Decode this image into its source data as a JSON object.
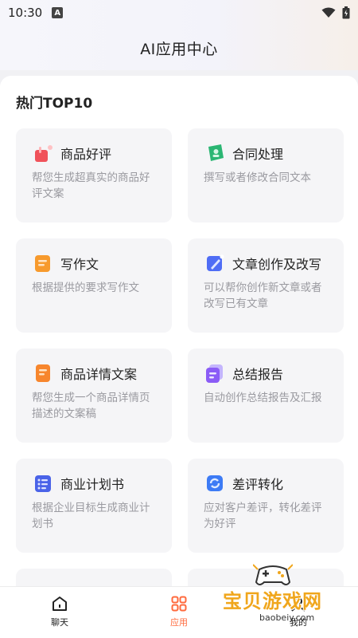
{
  "status": {
    "time": "10:30",
    "a_label": "A"
  },
  "header": {
    "title": "AI应用中心"
  },
  "section": {
    "title": "热门TOP10"
  },
  "cards": [
    {
      "title": "商品好评",
      "desc": "帮您生成超真实的商品好评文案",
      "icon": "gift-icon",
      "color": "#f0525a"
    },
    {
      "title": "合同处理",
      "desc": "撰写或者修改合同文本",
      "icon": "contract-icon",
      "color": "#2bb673"
    },
    {
      "title": "写作文",
      "desc": "根据提供的要求写作文",
      "icon": "essay-icon",
      "color": "#f79a2d"
    },
    {
      "title": "文章创作及改写",
      "desc": "可以帮你创作新文章或者改写已有文章",
      "icon": "pen-icon",
      "color": "#4f6df5"
    },
    {
      "title": "商品详情文案",
      "desc": "帮您生成一个商品详情页描述的文案稿",
      "icon": "document-icon",
      "color": "#f7862d"
    },
    {
      "title": "总结报告",
      "desc": "自动创作总结报告及汇报",
      "icon": "report-icon",
      "color": "#8b5cf6"
    },
    {
      "title": "商业计划书",
      "desc": "根据企业目标生成商业计划书",
      "icon": "plan-icon",
      "color": "#4a63e8"
    },
    {
      "title": "差评转化",
      "desc": "应对客户差评，转化差评为好评",
      "icon": "convert-icon",
      "color": "#3d7bf5"
    }
  ],
  "tabs": [
    {
      "label": "聊天",
      "icon": "home-icon",
      "active": false
    },
    {
      "label": "应用",
      "icon": "apps-icon",
      "active": true
    },
    {
      "label": "我的",
      "icon": "profile-icon",
      "active": false
    }
  ],
  "watermark": {
    "text": "宝贝游戏网",
    "url": "baobeiy.com"
  }
}
